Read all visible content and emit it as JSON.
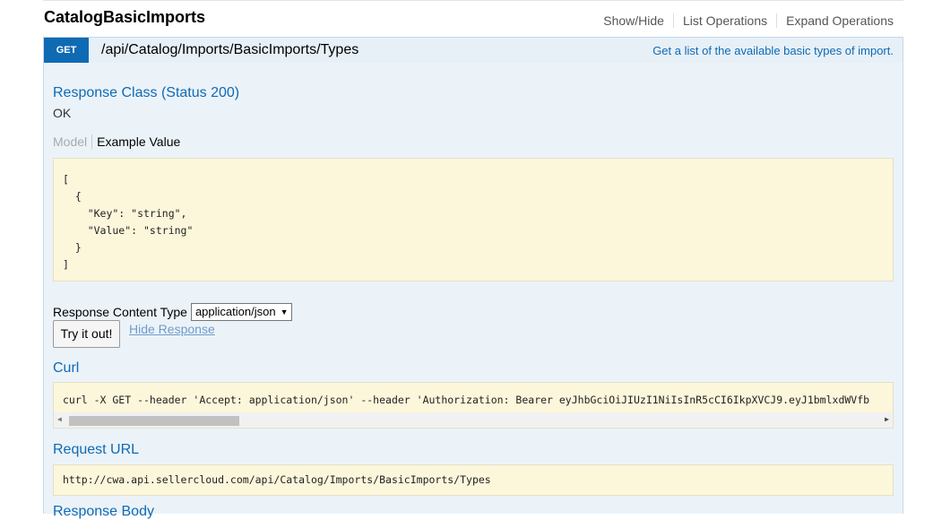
{
  "header": {
    "title": "CatalogBasicImports",
    "ops": [
      "Show/Hide",
      "List Operations",
      "Expand Operations"
    ]
  },
  "operation": {
    "method": "GET",
    "path": "/api/Catalog/Imports/BasicImports/Types",
    "summary": "Get a list of the available basic types of import."
  },
  "response_class": {
    "title": "Response Class (Status 200)",
    "status_text": "OK",
    "tab_model": "Model",
    "tab_example": "Example Value",
    "example": "[\n  {\n    \"Key\": \"string\",\n    \"Value\": \"string\"\n  }\n]"
  },
  "content_type": {
    "label": "Response Content Type",
    "selected": "application/json"
  },
  "actions": {
    "try_label": "Try it out!",
    "hide_label": "Hide Response"
  },
  "curl": {
    "title": "Curl",
    "command": "curl -X GET --header 'Accept: application/json' --header 'Authorization: Bearer eyJhbGciOiJIUzI1NiIsInR5cCI6IkpXVCJ9.eyJ1bmlxdWVfb"
  },
  "request_url": {
    "title": "Request URL",
    "value": "http://cwa.api.sellercloud.com/api/Catalog/Imports/BasicImports/Types"
  },
  "response_body": {
    "title": "Response Body"
  }
}
